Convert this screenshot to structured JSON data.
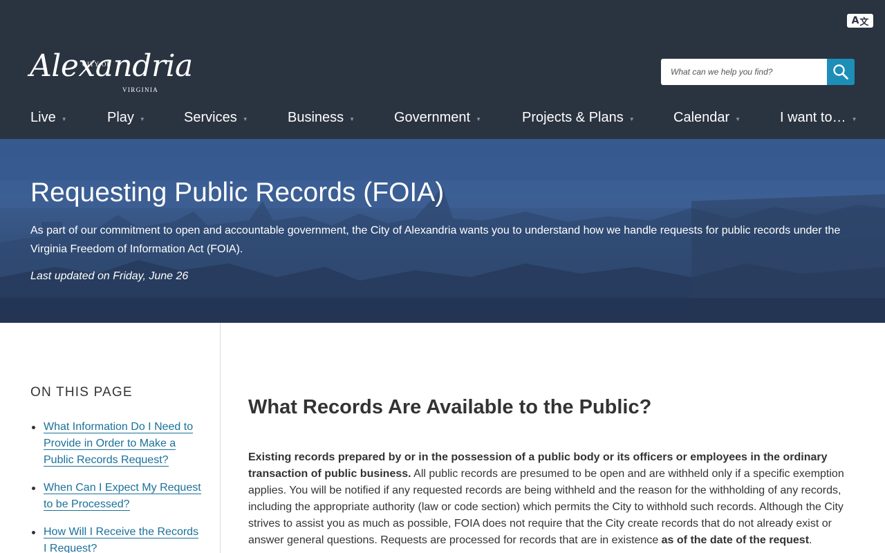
{
  "header": {
    "translate_label_a": "A",
    "translate_label_b": "文",
    "logo": {
      "city_of": "CITY OF",
      "name": "Alexandria",
      "state": "VIRGINIA"
    },
    "search": {
      "placeholder": "What can we help you find?"
    }
  },
  "nav": [
    {
      "label": "Live"
    },
    {
      "label": "Play"
    },
    {
      "label": "Services"
    },
    {
      "label": "Business"
    },
    {
      "label": "Government"
    },
    {
      "label": "Projects & Plans"
    },
    {
      "label": "Calendar"
    },
    {
      "label": "I want to…"
    }
  ],
  "nav_caret": "▼",
  "hero": {
    "title": "Requesting Public Records (FOIA)",
    "description": "As part of our commitment to open and accountable government, the City of Alexandria wants you to understand how we handle requests for public records under the Virginia Freedom of Information Act (FOIA).",
    "updated": "Last updated on Friday, June 26"
  },
  "sidebar": {
    "heading": "ON THIS PAGE",
    "links": [
      {
        "label": "What Information Do I Need to Provide in Order to Make a Public Records Request?"
      },
      {
        "label": "When Can I Expect My Request to be Processed?"
      },
      {
        "label": "How Will I Receive the Records I Request?"
      }
    ]
  },
  "main": {
    "heading": "What Records Are Available to the Public?",
    "bold_intro": "Existing records prepared by or in the possession of a public body or its officers or employees in the ordinary transaction of public business.",
    "body": " All public records are presumed to be open and are withheld only if a specific exemption applies. You will be notified if any requested records are being withheld and the reason for the withholding of any records, including the appropriate authority (law or code section) which permits the City to withhold such records. Although the City strives to assist you as much as possible, FOIA does not require that the City create records that do not already exist or answer general questions. Requests are processed for records that are in existence ",
    "bold_end": "as of the date of the request",
    "end_punct": "."
  },
  "colors": {
    "header_bg": "#2a3340",
    "search_button": "#1d8eb8",
    "link": "#19709a",
    "hero_blue": "#3b5d92"
  },
  "icons": {
    "translate": "translate-icon",
    "search": "search-icon",
    "caret": "caret-down-icon"
  }
}
